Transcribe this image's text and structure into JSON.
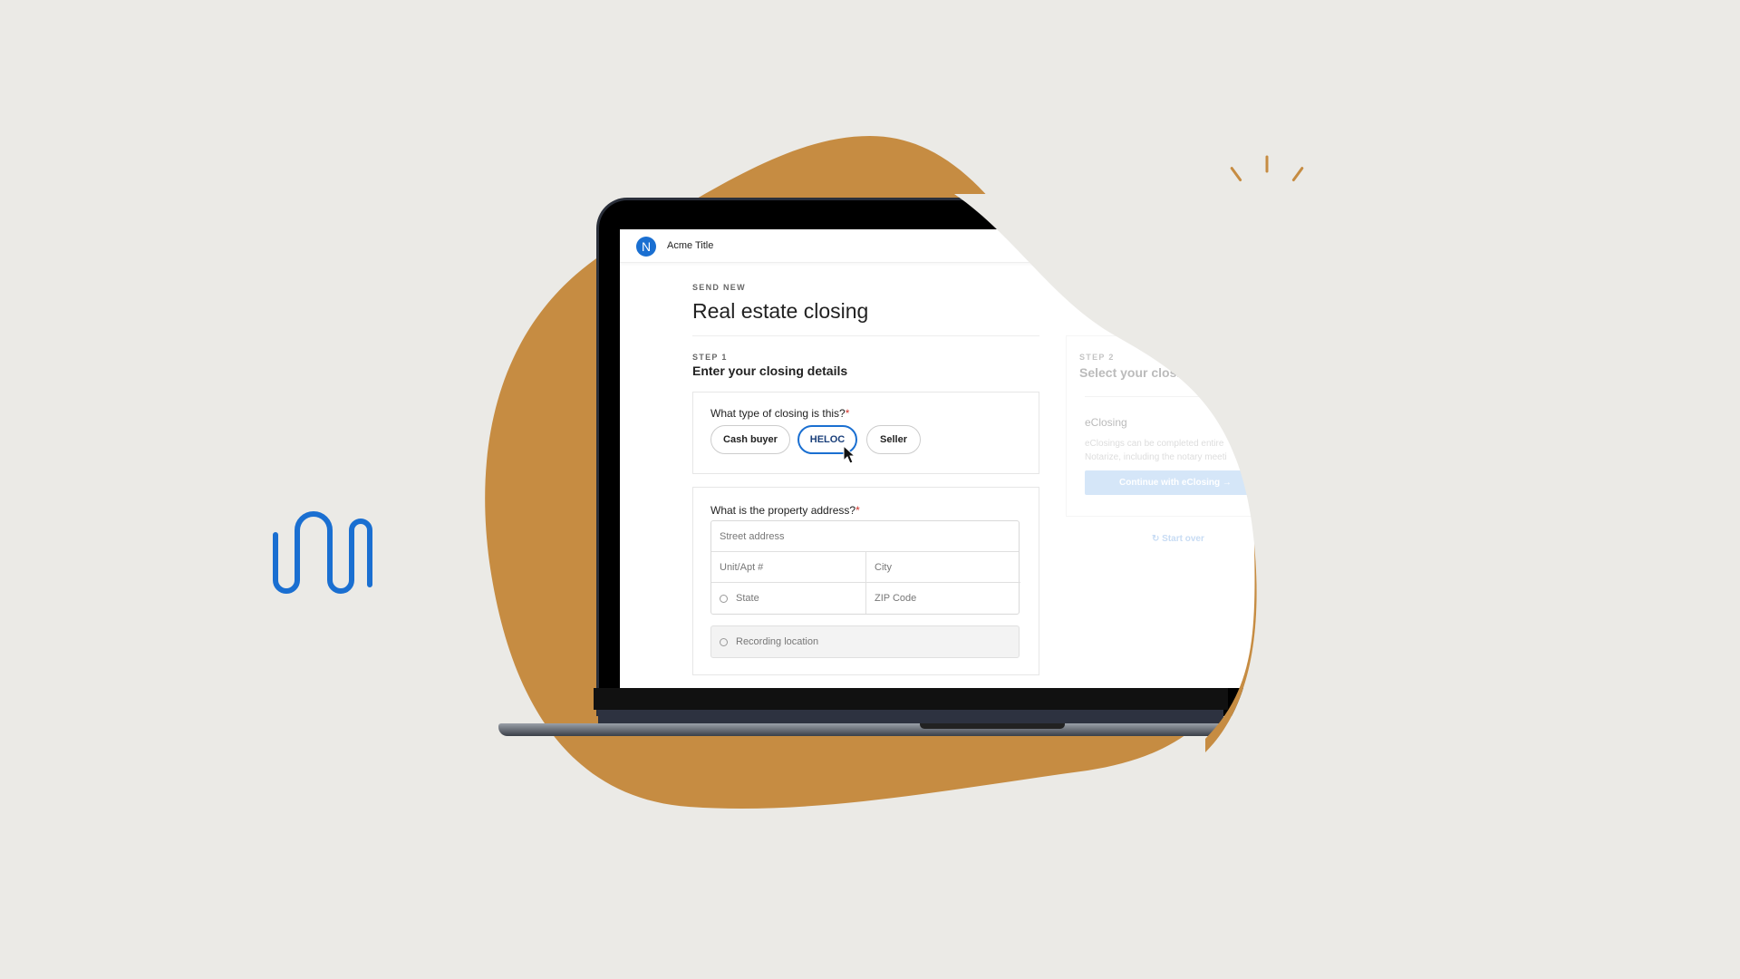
{
  "app": {
    "name": "Acme Title",
    "logo_letter": "N"
  },
  "page": {
    "eyebrow": "SEND NEW",
    "title": "Real estate closing"
  },
  "step1": {
    "label": "STEP 1",
    "title": "Enter your closing details",
    "closing_type": {
      "question": "What type of closing is this?",
      "required": "*",
      "options": [
        "Cash buyer",
        "HELOC",
        "Seller"
      ],
      "selected": "HELOC"
    },
    "address": {
      "question": "What is the property address?",
      "required": "*",
      "street_placeholder": "Street address",
      "unit_placeholder": "Unit/Apt #",
      "city_placeholder": "City",
      "state_placeholder": "State",
      "zip_placeholder": "ZIP Code",
      "recording_placeholder": "Recording location"
    }
  },
  "step2": {
    "label": "STEP 2",
    "title": "Select your closi",
    "option_title": "eClosing",
    "desc_line1": "eClosings can be completed entire",
    "desc_line2": "Notarize, including the notary meeti",
    "continue_label": "Continue with eClosing →",
    "start_over": "Start over"
  },
  "colors": {
    "accent": "#1a6fd1",
    "blob": "#c68c42",
    "background": "#ebeae6"
  }
}
